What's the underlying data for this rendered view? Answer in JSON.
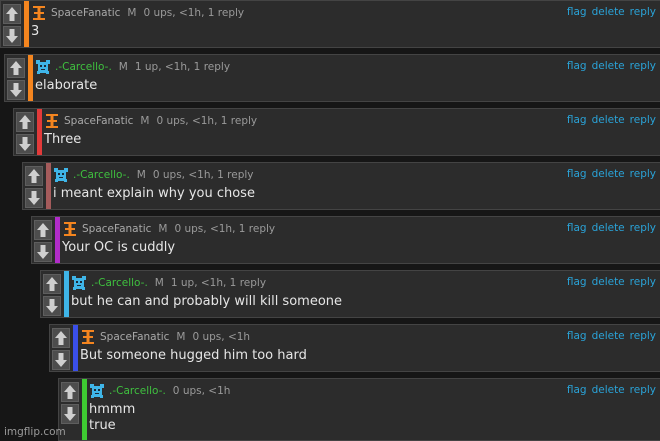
{
  "actions": {
    "flag": "flag",
    "delete": "delete",
    "reply": "reply"
  },
  "bar_colors": [
    "#f4851f",
    "#f4851f",
    "#e23a3a",
    "#a45b5b",
    "#b12cc9",
    "#3fb5e8",
    "#3a4fea",
    "#3ecb32"
  ],
  "icons": {
    "upvote": "arrow-up-icon",
    "downvote": "arrow-down-icon",
    "spacefanatic_avatar": "orange-cross-avatar-icon",
    "carcello_avatar": "blue-pixel-creature-avatar-icon"
  },
  "comments": [
    {
      "username": "SpaceFanatic",
      "gender": "M",
      "stats": "0 ups, <1h, 1 reply",
      "text": "3"
    },
    {
      "username": ".-Carcello-.",
      "gender": "M",
      "stats": "1 up, <1h, 1 reply",
      "text": "elaborate"
    },
    {
      "username": "SpaceFanatic",
      "gender": "M",
      "stats": "0 ups, <1h, 1 reply",
      "text": "Three"
    },
    {
      "username": ".-Carcello-.",
      "gender": "M",
      "stats": "0 ups, <1h, 1 reply",
      "text": "i meant explain why you chose"
    },
    {
      "username": "SpaceFanatic",
      "gender": "M",
      "stats": "0 ups, <1h, 1 reply",
      "text": "Your OC is cuddly"
    },
    {
      "username": ".-Carcello-.",
      "gender": "M",
      "stats": "1 up, <1h, 1 reply",
      "text": "but he can and probably will kill someone"
    },
    {
      "username": "SpaceFanatic",
      "gender": "M",
      "stats": "0 ups, <1h",
      "text": "But someone hugged him too hard"
    },
    {
      "username": ".-Carcello-.",
      "gender": "",
      "stats": "0 ups, <1h",
      "text": "hmmm\ntrue"
    }
  ],
  "watermark": "imgflip.com"
}
